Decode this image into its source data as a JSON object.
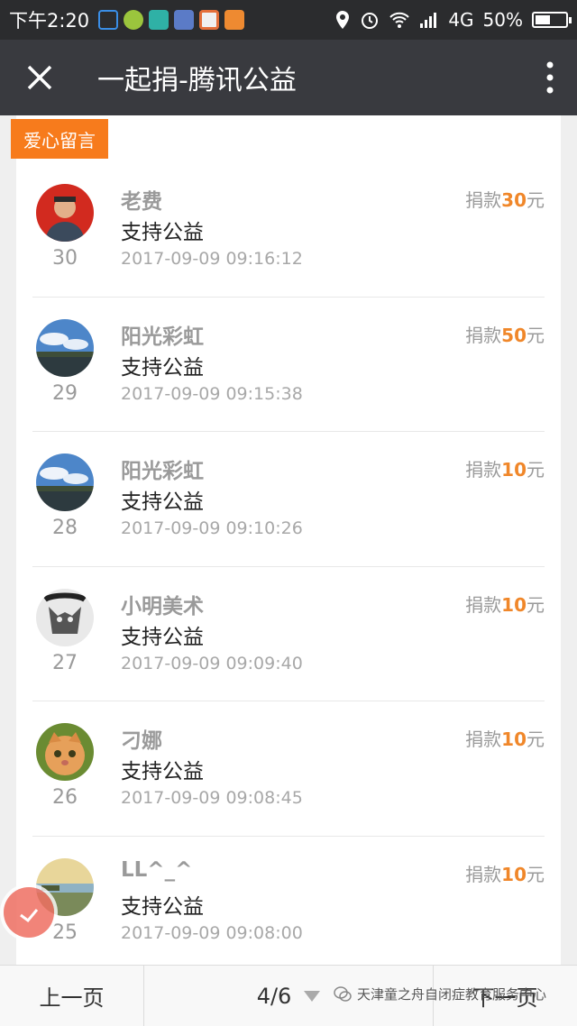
{
  "status_bar": {
    "time": "下午2:20",
    "network": "4G",
    "battery": "50%",
    "battery_level": 0.5
  },
  "header": {
    "title": "一起捐-腾讯公益"
  },
  "section": {
    "tag": "爱心留言"
  },
  "donation_label": "捐款",
  "currency_unit": "元",
  "messages": [
    {
      "name": "老费",
      "text": "支持公益",
      "time": "2017-09-09 09:16:12",
      "rank": "30",
      "amount": "30",
      "avatar": "portrait"
    },
    {
      "name": "阳光彩虹",
      "text": "支持公益",
      "time": "2017-09-09 09:15:38",
      "rank": "29",
      "amount": "50",
      "avatar": "landscape"
    },
    {
      "name": "阳光彩虹",
      "text": "支持公益",
      "time": "2017-09-09 09:10:26",
      "rank": "28",
      "amount": "10",
      "avatar": "landscape"
    },
    {
      "name": "小明美术",
      "text": "支持公益",
      "time": "2017-09-09 09:09:40",
      "rank": "27",
      "amount": "10",
      "avatar": "sketch"
    },
    {
      "name": "刁娜",
      "text": "支持公益",
      "time": "2017-09-09 09:08:45",
      "rank": "26",
      "amount": "10",
      "avatar": "cat"
    },
    {
      "name": "LL^_^",
      "text": "支持公益",
      "time": "2017-09-09 09:08:00",
      "rank": "25",
      "amount": "10",
      "avatar": "beach"
    }
  ],
  "pagination": {
    "prev": "上一页",
    "page": "4/6",
    "next": "下一页"
  },
  "watermark": "天津童之舟自闭症教育服务中心",
  "colors": {
    "accent": "#f77b1c",
    "amount": "#f0872a",
    "header": "#393a3f"
  }
}
